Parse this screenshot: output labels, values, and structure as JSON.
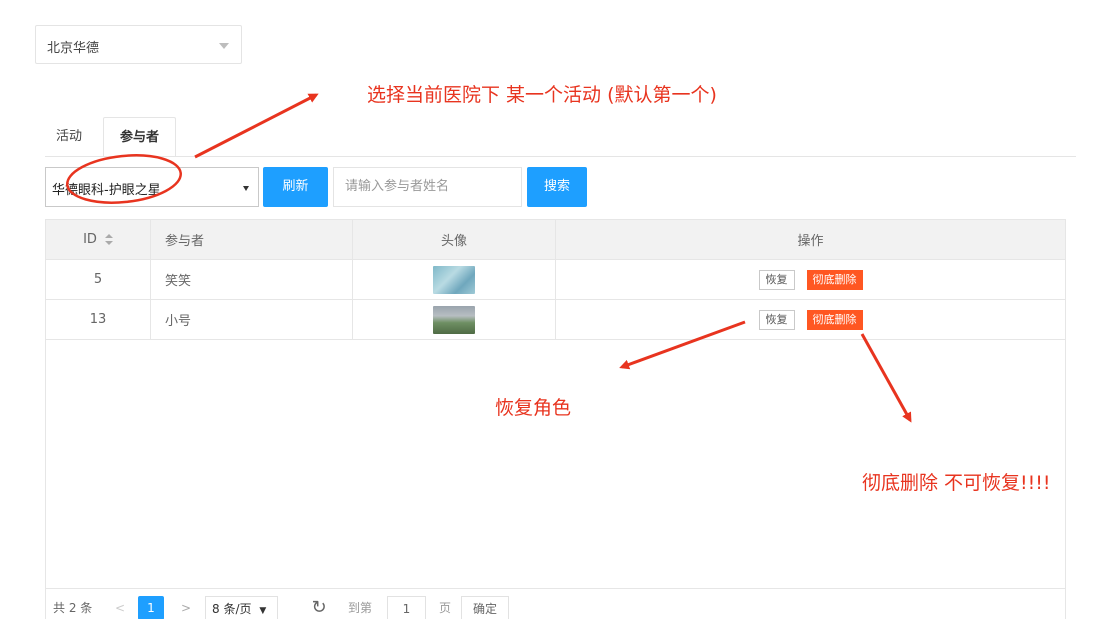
{
  "hospital_select": {
    "value": "北京华德"
  },
  "tabs": [
    {
      "label": "活动",
      "active": false
    },
    {
      "label": "参与者",
      "active": true
    }
  ],
  "filter": {
    "activity_value": "华德眼科-护眼之星",
    "refresh_label": "刷新",
    "search_placeholder": "请输入参与者姓名",
    "search_label": "搜索"
  },
  "table": {
    "headers": {
      "id": "ID",
      "name": "参与者",
      "avatar": "头像",
      "ops": "操作"
    },
    "rows": [
      {
        "id": "5",
        "name": "笑笑",
        "restore": "恢复",
        "delete": "彻底删除"
      },
      {
        "id": "13",
        "name": "小号",
        "restore": "恢复",
        "delete": "彻底删除"
      }
    ]
  },
  "pagination": {
    "total": "共 2 条",
    "prev": "<",
    "current": "1",
    "next": ">",
    "page_size": "8 条/页",
    "goto": "到第",
    "goto_value": "1",
    "unit": "页",
    "confirm": "确定"
  },
  "annotations": {
    "select_activity": "选择当前医院下 某一个活动 (默认第一个)",
    "restore_role": "恢复角色",
    "delete_forever": "彻底删除 不可恢复!!!!"
  },
  "colors": {
    "primary": "#1e9fff",
    "danger": "#ff5722",
    "annotation": "#e8341f"
  }
}
